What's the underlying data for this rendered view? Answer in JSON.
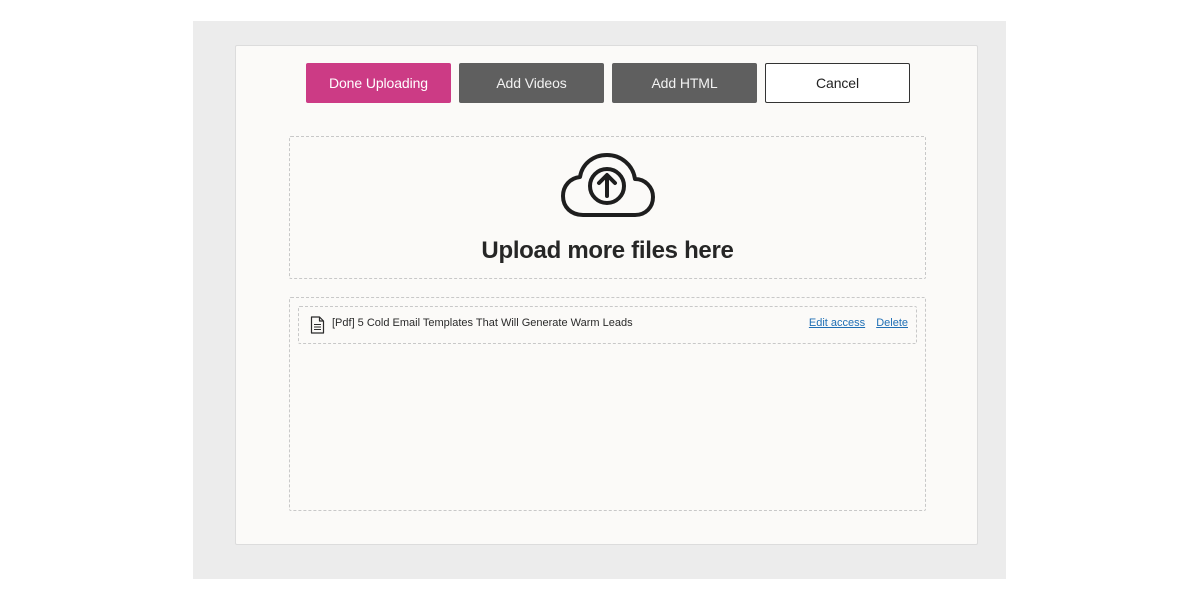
{
  "toolbar": {
    "done_label": "Done Uploading",
    "add_videos_label": "Add Videos",
    "add_html_label": "Add HTML",
    "cancel_label": "Cancel"
  },
  "dropzone": {
    "icon": "cloud-upload-icon",
    "title": "Upload more files here"
  },
  "files": [
    {
      "icon": "document-icon",
      "name": "[Pdf] 5 Cold Email Templates That Will Generate Warm Leads",
      "edit_label": "Edit access",
      "delete_label": "Delete"
    }
  ],
  "colors": {
    "primary": "#cc3b85",
    "secondary": "#5f5f5f",
    "link": "#1f6fb5"
  }
}
